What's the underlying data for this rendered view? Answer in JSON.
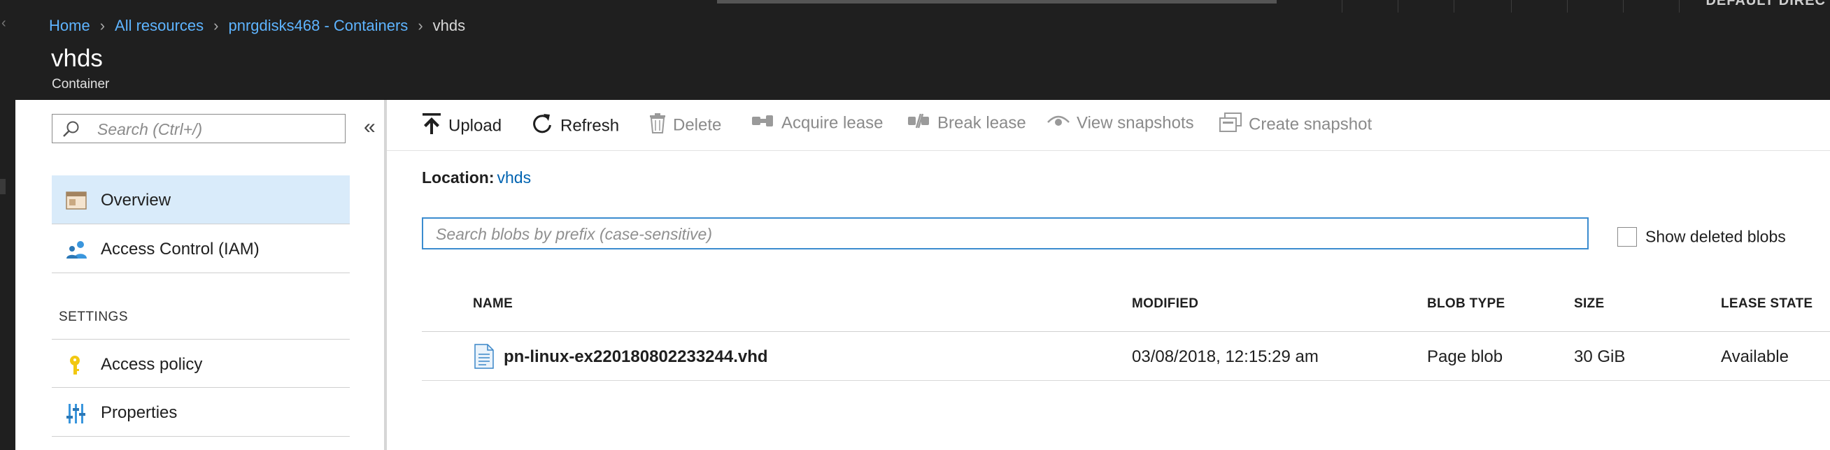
{
  "header": {
    "breadcrumb": [
      {
        "label": "Home"
      },
      {
        "label": "All resources"
      },
      {
        "label": "pnrgdisks468 - Containers"
      }
    ],
    "breadcrumb_current": "vhds",
    "title": "vhds",
    "subtitle": "Container",
    "directory_label": "DEFAULT DIREC"
  },
  "menu": {
    "search_placeholder": "Search (Ctrl+/)",
    "collapse_glyph": "«",
    "items": [
      {
        "label": "Overview",
        "icon": "overview-icon",
        "active": true
      },
      {
        "label": "Access Control (IAM)",
        "icon": "iam-people-icon",
        "active": false
      }
    ],
    "settings_header": "SETTINGS",
    "settings_items": [
      {
        "label": "Access policy",
        "icon": "key-icon"
      },
      {
        "label": "Properties",
        "icon": "properties-sliders-icon"
      }
    ]
  },
  "toolbar": {
    "upload": "Upload",
    "refresh": "Refresh",
    "delete": "Delete",
    "acquire_lease": "Acquire lease",
    "break_lease": "Break lease",
    "view_snapshots": "View snapshots",
    "create_snapshot": "Create snapshot"
  },
  "location": {
    "label": "Location:",
    "value": "vhds"
  },
  "blob_search": {
    "placeholder": "Search blobs by prefix (case-sensitive)",
    "value": ""
  },
  "show_deleted": {
    "label": "Show deleted blobs",
    "checked": false
  },
  "table": {
    "columns": [
      "NAME",
      "MODIFIED",
      "BLOB TYPE",
      "SIZE",
      "LEASE STATE"
    ],
    "rows": [
      {
        "name": "pn-linux-ex220180802233244.vhd",
        "modified": "03/08/2018, 12:15:29 am",
        "blob_type": "Page blob",
        "size": "30 GiB",
        "lease_state": "Available"
      }
    ]
  },
  "colors": {
    "header_bg": "#1f1f1f",
    "breadcrumb_link": "#5eb4ff",
    "link": "#0063b1",
    "active_menu_bg": "#d9ebfa",
    "search_focus_border": "#3b8ccf",
    "disabled_text": "#8a8a8a"
  }
}
